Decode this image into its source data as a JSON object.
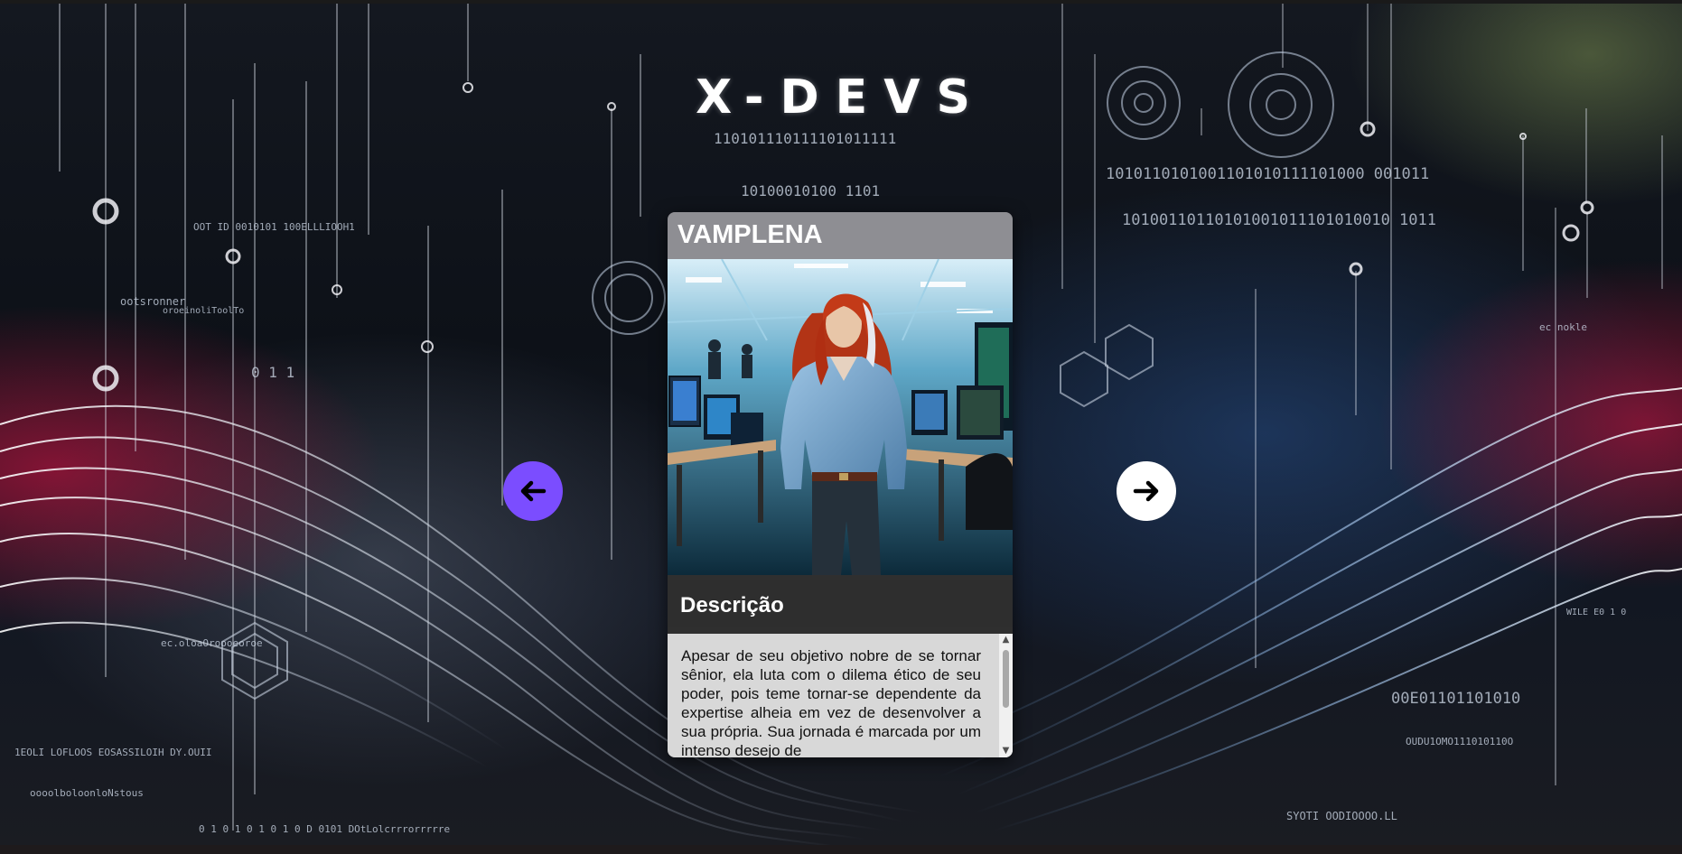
{
  "site": {
    "title": "X-DEVS"
  },
  "background": {
    "binary_lines": [
      "110101110111101011111",
      "10100010100 1101",
      "1010110101001101010111101000 001011",
      "10100110110101001011101010010 1011",
      "OOT ID 0010101 100ELLLIOOH1",
      "ootsronner",
      "oroeinoliToolTo",
      "0 1 1",
      "ec.oloaOroooeoroe",
      "00E01101101010",
      "OUDU1OMO111010110O",
      "1EOLI LOFLOOS EOSASSILOIH DY.OUII",
      "oooolboloonloNstous",
      "0 1 0 1 0 1 0 1 0 D 0101 DOtLolcrrrorrrrre",
      "SYOTI OODIOOOO.LL",
      "ec nokle",
      "WILE E0 1 0"
    ]
  },
  "card": {
    "name": "VAMPLENA",
    "image_alt": "Illustration of a red-haired developer in a blue shirt standing in an office with monitors",
    "description_label": "Descrição",
    "description": "Apesar de seu objetivo nobre de se tornar sênior, ela luta com o dilema ético de seu poder, pois teme tornar-se dependente da expertise alheia em vez de desenvolver a sua própria. Sua jornada é marcada por um intenso desejo de"
  },
  "navigation": {
    "prev_icon": "arrow-left-icon",
    "next_icon": "arrow-right-icon"
  },
  "colors": {
    "prev_button": "#7b4dff",
    "next_button": "#ffffff",
    "card_header": "#8e8e93",
    "description_header": "#2e2e2e",
    "description_box": "#d8d8d8"
  }
}
